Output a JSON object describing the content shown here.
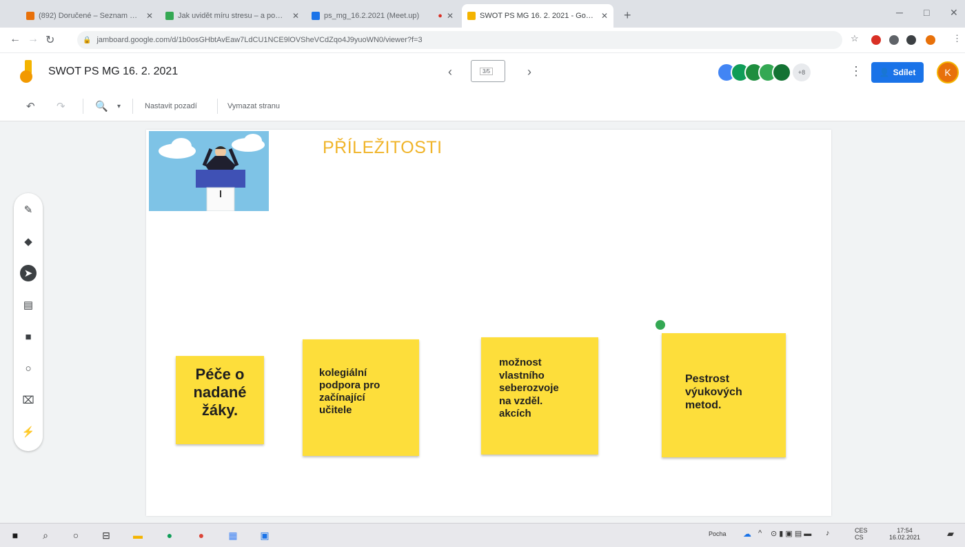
{
  "browser": {
    "tabs": [
      {
        "label": "(892) Doručené – Seznam Email",
        "color": "#e8710a"
      },
      {
        "label": "Jak uvidět míru stresu – a pomoci",
        "color": "#34a853"
      },
      {
        "label": "ps_mg_16.2.2021 (Meet.up)",
        "color": "#1a73e8"
      },
      {
        "label": "SWOT PS MG 16. 2. 2021 - Goo…",
        "color": "#f4b400",
        "active": true
      }
    ],
    "new_tab": "+",
    "url": "jamboard.google.com/d/1b0osGHbtAvEaw7LdCU1NCE9lOVSheVCdZqo4J9yuoWN0/viewer?f=3"
  },
  "header": {
    "title": "SWOT PS MG 16. 2. 2021",
    "frame_indicator": "3/5",
    "prev": "‹",
    "next": "›",
    "collaborators_more": "+8",
    "share_label": "Sdílet",
    "user_initial": "K"
  },
  "toolbar": {
    "set_background": "Nastavit pozadí",
    "clear_frame": "Vymazat stranu"
  },
  "frame": {
    "heading": "PŘÍLEŽITOSTI",
    "notes": [
      {
        "line1": "Péče o",
        "line2": "nadané",
        "line3": "žáky."
      },
      {
        "lines": [
          "kolegiální",
          "podpora pro",
          "začínající",
          "učitele"
        ]
      },
      {
        "lines": [
          "možnost",
          "vlastního",
          "seberozvoje",
          "na vzděl.",
          "akcích"
        ]
      },
      {
        "lines": [
          "Pestrost",
          "výukových",
          "metod."
        ]
      }
    ]
  },
  "taskbar": {
    "weather": "Pocha",
    "lang": "CES",
    "lang2": "CS",
    "time": "17:54",
    "date": "16.02.2021"
  },
  "colors": {
    "sticky": "#fdde3b",
    "heading": "#f0b429",
    "share": "#1a73e8"
  }
}
